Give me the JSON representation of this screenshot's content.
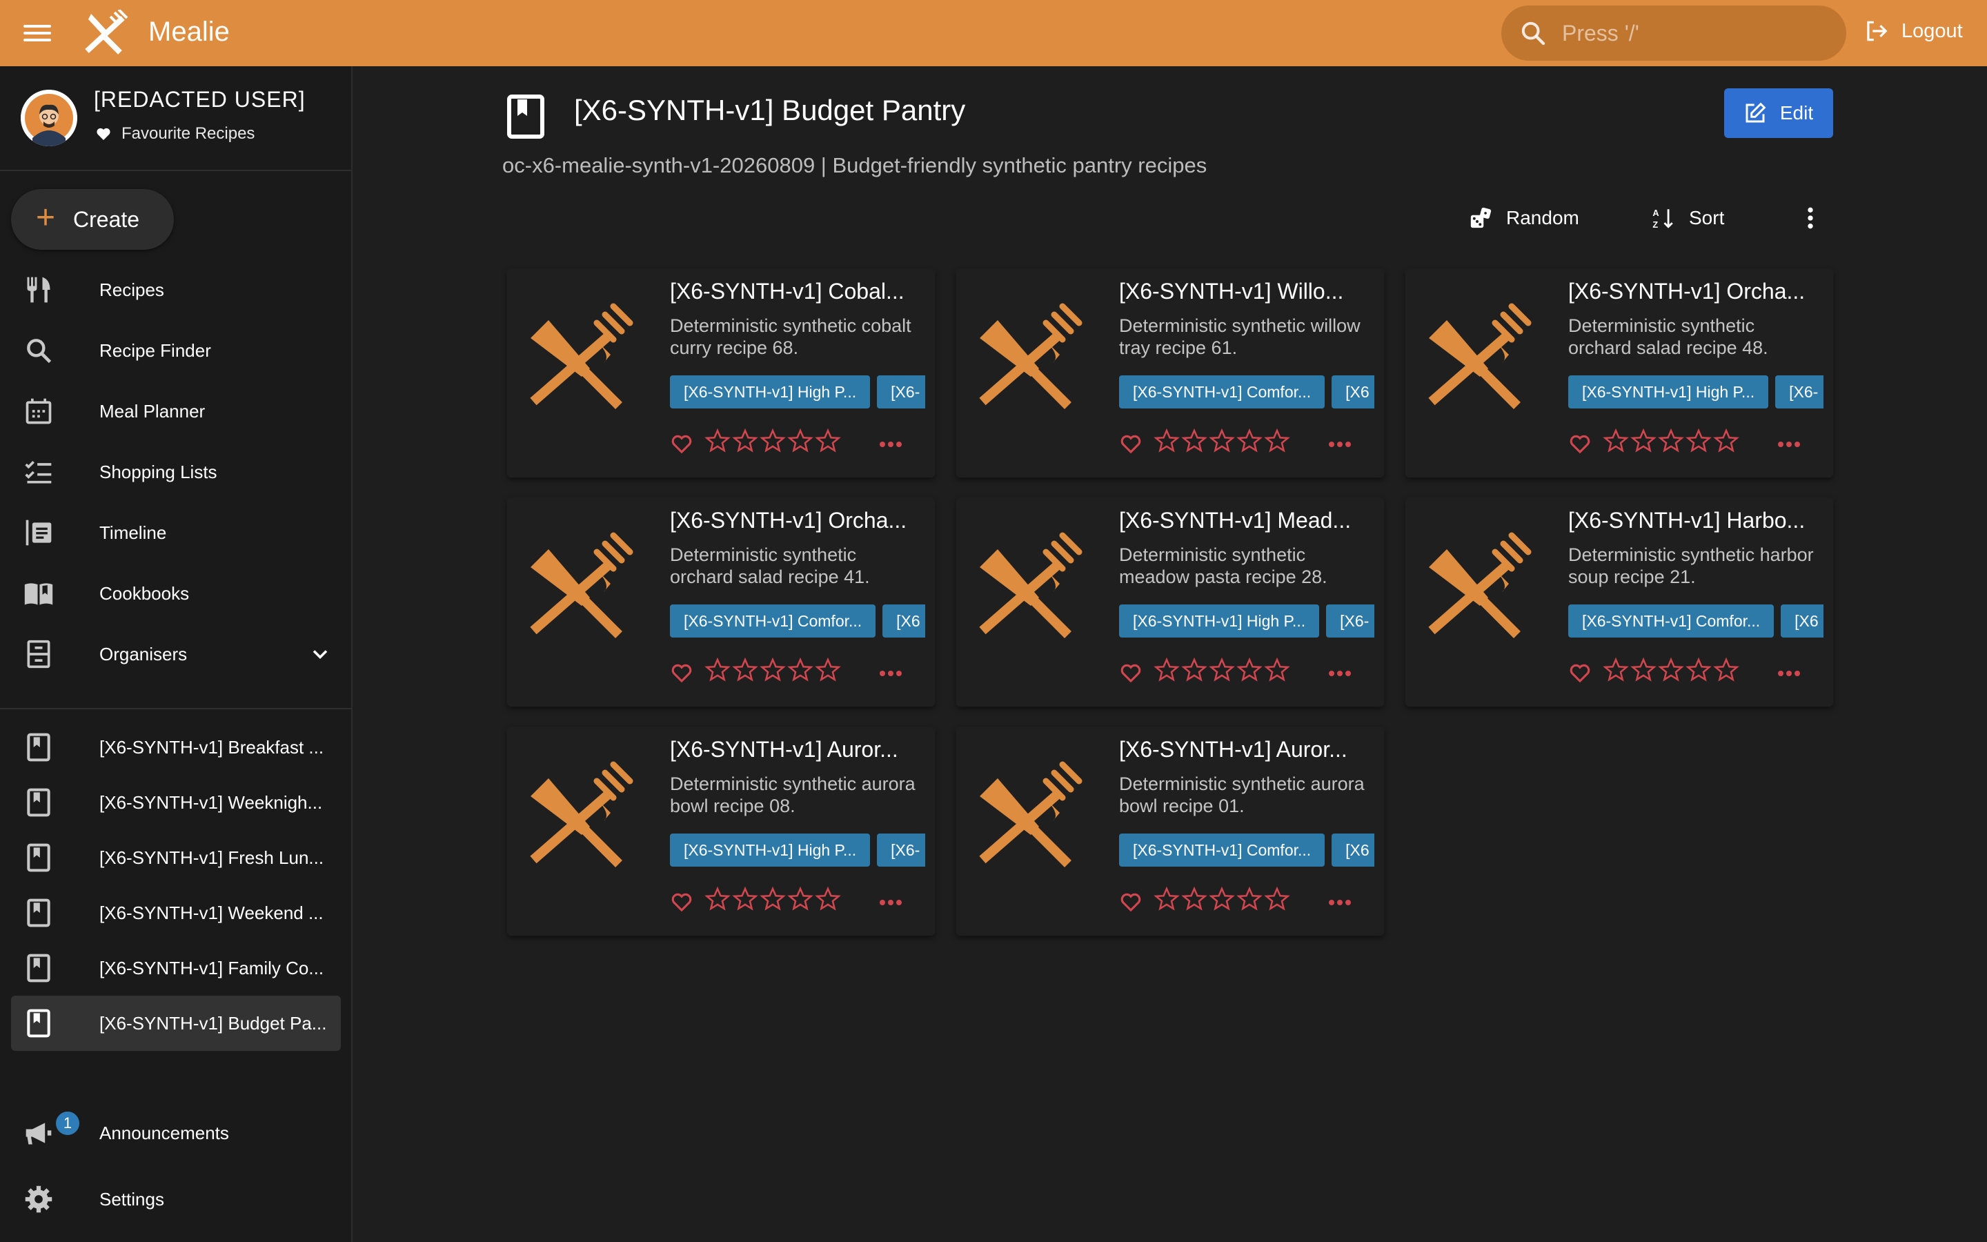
{
  "app": {
    "brand": "Mealie"
  },
  "header": {
    "search_placeholder": "Press '/'",
    "logout_label": "Logout"
  },
  "sidebar": {
    "user_name": "[REDACTED USER]",
    "favourites_label": "Favourite Recipes",
    "create_label": "Create",
    "nav": [
      {
        "label": "Recipes",
        "icon": "fork-knife-icon"
      },
      {
        "label": "Recipe Finder",
        "icon": "search-icon"
      },
      {
        "label": "Meal Planner",
        "icon": "calendar-icon"
      },
      {
        "label": "Shopping Lists",
        "icon": "checklist-icon"
      },
      {
        "label": "Timeline",
        "icon": "timeline-icon"
      },
      {
        "label": "Cookbooks",
        "icon": "book-open-icon"
      },
      {
        "label": "Organisers",
        "icon": "file-cabinet-icon"
      }
    ],
    "cookbooks": [
      "[X6-SYNTH-v1] Breakfast ...",
      "[X6-SYNTH-v1] Weeknigh...",
      "[X6-SYNTH-v1] Fresh Lun...",
      "[X6-SYNTH-v1] Weekend ...",
      "[X6-SYNTH-v1] Family Co...",
      "[X6-SYNTH-v1] Budget Pa..."
    ],
    "announcements_label": "Announcements",
    "announcements_count": "1",
    "settings_label": "Settings"
  },
  "page": {
    "title": "[X6-SYNTH-v1] Budget Pantry",
    "description": "oc-x6-mealie-synth-v1-20260809 | Budget-friendly synthetic pantry recipes",
    "edit_label": "Edit",
    "random_label": "Random",
    "sort_label": "Sort"
  },
  "colors": {
    "accent": "#de8c3f",
    "tag": "#2d7aa8",
    "edit": "#2f6fd1",
    "rating": "#d2474f"
  },
  "recipes": [
    {
      "title": "[X6-SYNTH-v1] Cobal...",
      "desc": "Deterministic synthetic cobalt curry recipe 68.",
      "tags": [
        "[X6-SYNTH-v1] High P...",
        "[X6-"
      ]
    },
    {
      "title": "[X6-SYNTH-v1] Willo...",
      "desc": "Deterministic synthetic willow tray recipe 61.",
      "tags": [
        "[X6-SYNTH-v1] Comfor...",
        "[X6"
      ]
    },
    {
      "title": "[X6-SYNTH-v1] Orcha...",
      "desc": "Deterministic synthetic orchard salad recipe 48.",
      "tags": [
        "[X6-SYNTH-v1] High P...",
        "[X6-"
      ]
    },
    {
      "title": "[X6-SYNTH-v1] Orcha...",
      "desc": "Deterministic synthetic orchard salad recipe 41.",
      "tags": [
        "[X6-SYNTH-v1] Comfor...",
        "[X6"
      ]
    },
    {
      "title": "[X6-SYNTH-v1] Mead...",
      "desc": "Deterministic synthetic meadow pasta recipe 28.",
      "tags": [
        "[X6-SYNTH-v1] High P...",
        "[X6-"
      ]
    },
    {
      "title": "[X6-SYNTH-v1] Harbo...",
      "desc": "Deterministic synthetic harbor soup recipe 21.",
      "tags": [
        "[X6-SYNTH-v1] Comfor...",
        "[X6"
      ]
    },
    {
      "title": "[X6-SYNTH-v1] Auror...",
      "desc": "Deterministic synthetic aurora bowl recipe 08.",
      "tags": [
        "[X6-SYNTH-v1] High P...",
        "[X6-"
      ]
    },
    {
      "title": "[X6-SYNTH-v1] Auror...",
      "desc": "Deterministic synthetic aurora bowl recipe 01.",
      "tags": [
        "[X6-SYNTH-v1] Comfor...",
        "[X6"
      ]
    }
  ]
}
